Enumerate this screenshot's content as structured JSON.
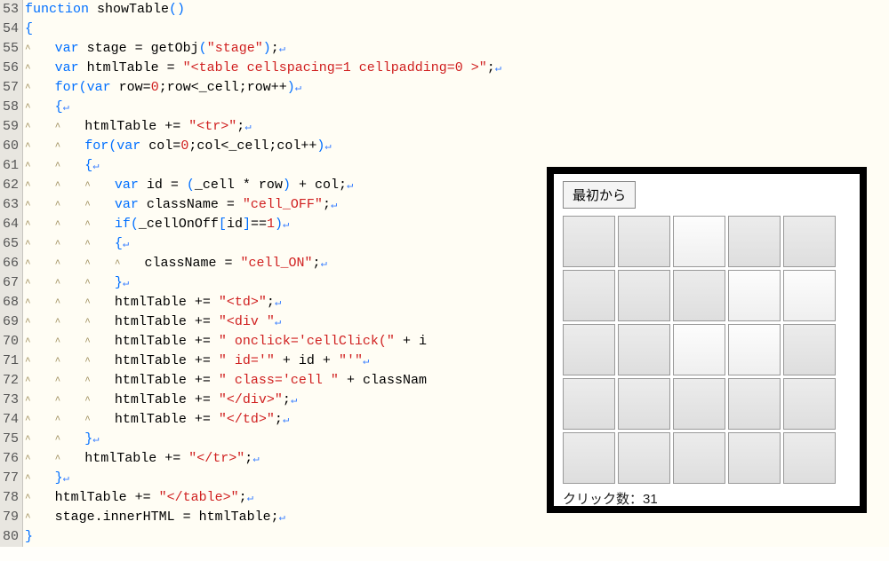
{
  "line_start": 53,
  "code_lines": [
    [
      {
        "c": "kw",
        "t": "function"
      },
      {
        "t": " showTable"
      },
      {
        "c": "punc-blue",
        "t": "()"
      }
    ],
    [
      {
        "c": "punc-blue",
        "t": "{"
      }
    ],
    [
      {
        "indent": 1
      },
      {
        "c": "kw",
        "t": "var"
      },
      {
        "t": " stage = getObj"
      },
      {
        "c": "punc-blue",
        "t": "("
      },
      {
        "c": "str",
        "t": "\"stage\""
      },
      {
        "c": "punc-blue",
        "t": ")"
      },
      {
        "t": ";"
      },
      {
        "eol": 1
      }
    ],
    [
      {
        "indent": 1
      },
      {
        "c": "kw",
        "t": "var"
      },
      {
        "t": " htmlTable = "
      },
      {
        "c": "str",
        "t": "\"<table cellspacing=1 cellpadding=0 >\""
      },
      {
        "t": ";"
      },
      {
        "eol": 1
      }
    ],
    [
      {
        "indent": 1
      },
      {
        "c": "kw",
        "t": "for"
      },
      {
        "c": "punc-blue",
        "t": "("
      },
      {
        "c": "kw",
        "t": "var"
      },
      {
        "t": " row="
      },
      {
        "c": "num",
        "t": "0"
      },
      {
        "t": ";row<_cell;row++"
      },
      {
        "c": "punc-blue",
        "t": ")"
      },
      {
        "eol": 1
      }
    ],
    [
      {
        "indent": 1
      },
      {
        "c": "punc-blue",
        "t": "{"
      },
      {
        "eol": 1
      }
    ],
    [
      {
        "indent": 2
      },
      {
        "t": "htmlTable += "
      },
      {
        "c": "str",
        "t": "\"<tr>\""
      },
      {
        "t": ";"
      },
      {
        "eol": 1
      }
    ],
    [
      {
        "indent": 2
      },
      {
        "c": "kw",
        "t": "for"
      },
      {
        "c": "punc-blue",
        "t": "("
      },
      {
        "c": "kw",
        "t": "var"
      },
      {
        "t": " col="
      },
      {
        "c": "num",
        "t": "0"
      },
      {
        "t": ";col<_cell;col++"
      },
      {
        "c": "punc-blue",
        "t": ")"
      },
      {
        "eol": 1
      }
    ],
    [
      {
        "indent": 2
      },
      {
        "c": "punc-blue",
        "t": "{"
      },
      {
        "eol": 1
      }
    ],
    [
      {
        "indent": 3
      },
      {
        "c": "kw",
        "t": "var"
      },
      {
        "t": " id = "
      },
      {
        "c": "punc-blue",
        "t": "("
      },
      {
        "t": "_cell * row"
      },
      {
        "c": "punc-blue",
        "t": ")"
      },
      {
        "t": " + col;"
      },
      {
        "eol": 1
      }
    ],
    [
      {
        "indent": 3
      },
      {
        "c": "kw",
        "t": "var"
      },
      {
        "t": " className = "
      },
      {
        "c": "str",
        "t": "\"cell_OFF\""
      },
      {
        "t": ";"
      },
      {
        "eol": 1
      }
    ],
    [
      {
        "indent": 3
      },
      {
        "c": "kw",
        "t": "if"
      },
      {
        "c": "punc-blue",
        "t": "("
      },
      {
        "t": "_cellOnOff"
      },
      {
        "c": "punc-blue",
        "t": "["
      },
      {
        "t": "id"
      },
      {
        "c": "punc-blue",
        "t": "]"
      },
      {
        "t": "=="
      },
      {
        "c": "num",
        "t": "1"
      },
      {
        "c": "punc-blue",
        "t": ")"
      },
      {
        "eol": 1
      }
    ],
    [
      {
        "indent": 3
      },
      {
        "c": "punc-blue",
        "t": "{"
      },
      {
        "eol": 1
      }
    ],
    [
      {
        "indent": 4
      },
      {
        "t": "className = "
      },
      {
        "c": "str",
        "t": "\"cell_ON\""
      },
      {
        "t": ";"
      },
      {
        "eol": 1
      }
    ],
    [
      {
        "indent": 3
      },
      {
        "c": "punc-blue",
        "t": "}"
      },
      {
        "eol": 1
      }
    ],
    [
      {
        "indent": 3
      },
      {
        "t": "htmlTable += "
      },
      {
        "c": "str",
        "t": "\"<td>\""
      },
      {
        "t": ";"
      },
      {
        "eol": 1
      }
    ],
    [
      {
        "indent": 3
      },
      {
        "t": "htmlTable += "
      },
      {
        "c": "str",
        "t": "\"<div \""
      },
      {
        "eol": 1
      }
    ],
    [
      {
        "indent": 3
      },
      {
        "t": "htmlTable += "
      },
      {
        "c": "str",
        "t": "\" onclick='cellClick(\""
      },
      {
        "t": " + i"
      }
    ],
    [
      {
        "indent": 3
      },
      {
        "t": "htmlTable += "
      },
      {
        "c": "str",
        "t": "\" id='\""
      },
      {
        "t": " + id + "
      },
      {
        "c": "str",
        "t": "\"'\""
      },
      {
        "eol": 1
      }
    ],
    [
      {
        "indent": 3
      },
      {
        "t": "htmlTable += "
      },
      {
        "c": "str",
        "t": "\" class='cell \""
      },
      {
        "t": " + classNam"
      }
    ],
    [
      {
        "indent": 3
      },
      {
        "t": "htmlTable += "
      },
      {
        "c": "str",
        "t": "\"</div>\""
      },
      {
        "t": ";"
      },
      {
        "eol": 1
      }
    ],
    [
      {
        "indent": 3
      },
      {
        "t": "htmlTable += "
      },
      {
        "c": "str",
        "t": "\"</td>\""
      },
      {
        "t": ";"
      },
      {
        "eol": 1
      }
    ],
    [
      {
        "indent": 2
      },
      {
        "c": "punc-blue",
        "t": "}"
      },
      {
        "eol": 1
      }
    ],
    [
      {
        "indent": 2
      },
      {
        "t": "htmlTable += "
      },
      {
        "c": "str",
        "t": "\"</tr>\""
      },
      {
        "t": ";"
      },
      {
        "eol": 1
      }
    ],
    [
      {
        "indent": 1
      },
      {
        "c": "punc-blue",
        "t": "}"
      },
      {
        "eol": 1
      }
    ],
    [
      {
        "indent": 1
      },
      {
        "t": "htmlTable += "
      },
      {
        "c": "str",
        "t": "\"</table>\""
      },
      {
        "t": ";"
      },
      {
        "eol": 1
      }
    ],
    [
      {
        "indent": 1
      },
      {
        "t": "stage.innerHTML = htmlTable;"
      },
      {
        "eol": 1
      }
    ],
    [
      {
        "c": "punc-blue",
        "t": "}"
      }
    ]
  ],
  "overlay": {
    "reset_button": "最初から",
    "grid": [
      [
        0,
        0,
        1,
        0,
        0
      ],
      [
        0,
        0,
        0,
        1,
        1
      ],
      [
        0,
        0,
        1,
        1,
        0
      ],
      [
        0,
        0,
        0,
        0,
        0
      ],
      [
        0,
        0,
        0,
        0,
        0
      ]
    ],
    "count_label": "クリック数：",
    "count_value": 31
  }
}
